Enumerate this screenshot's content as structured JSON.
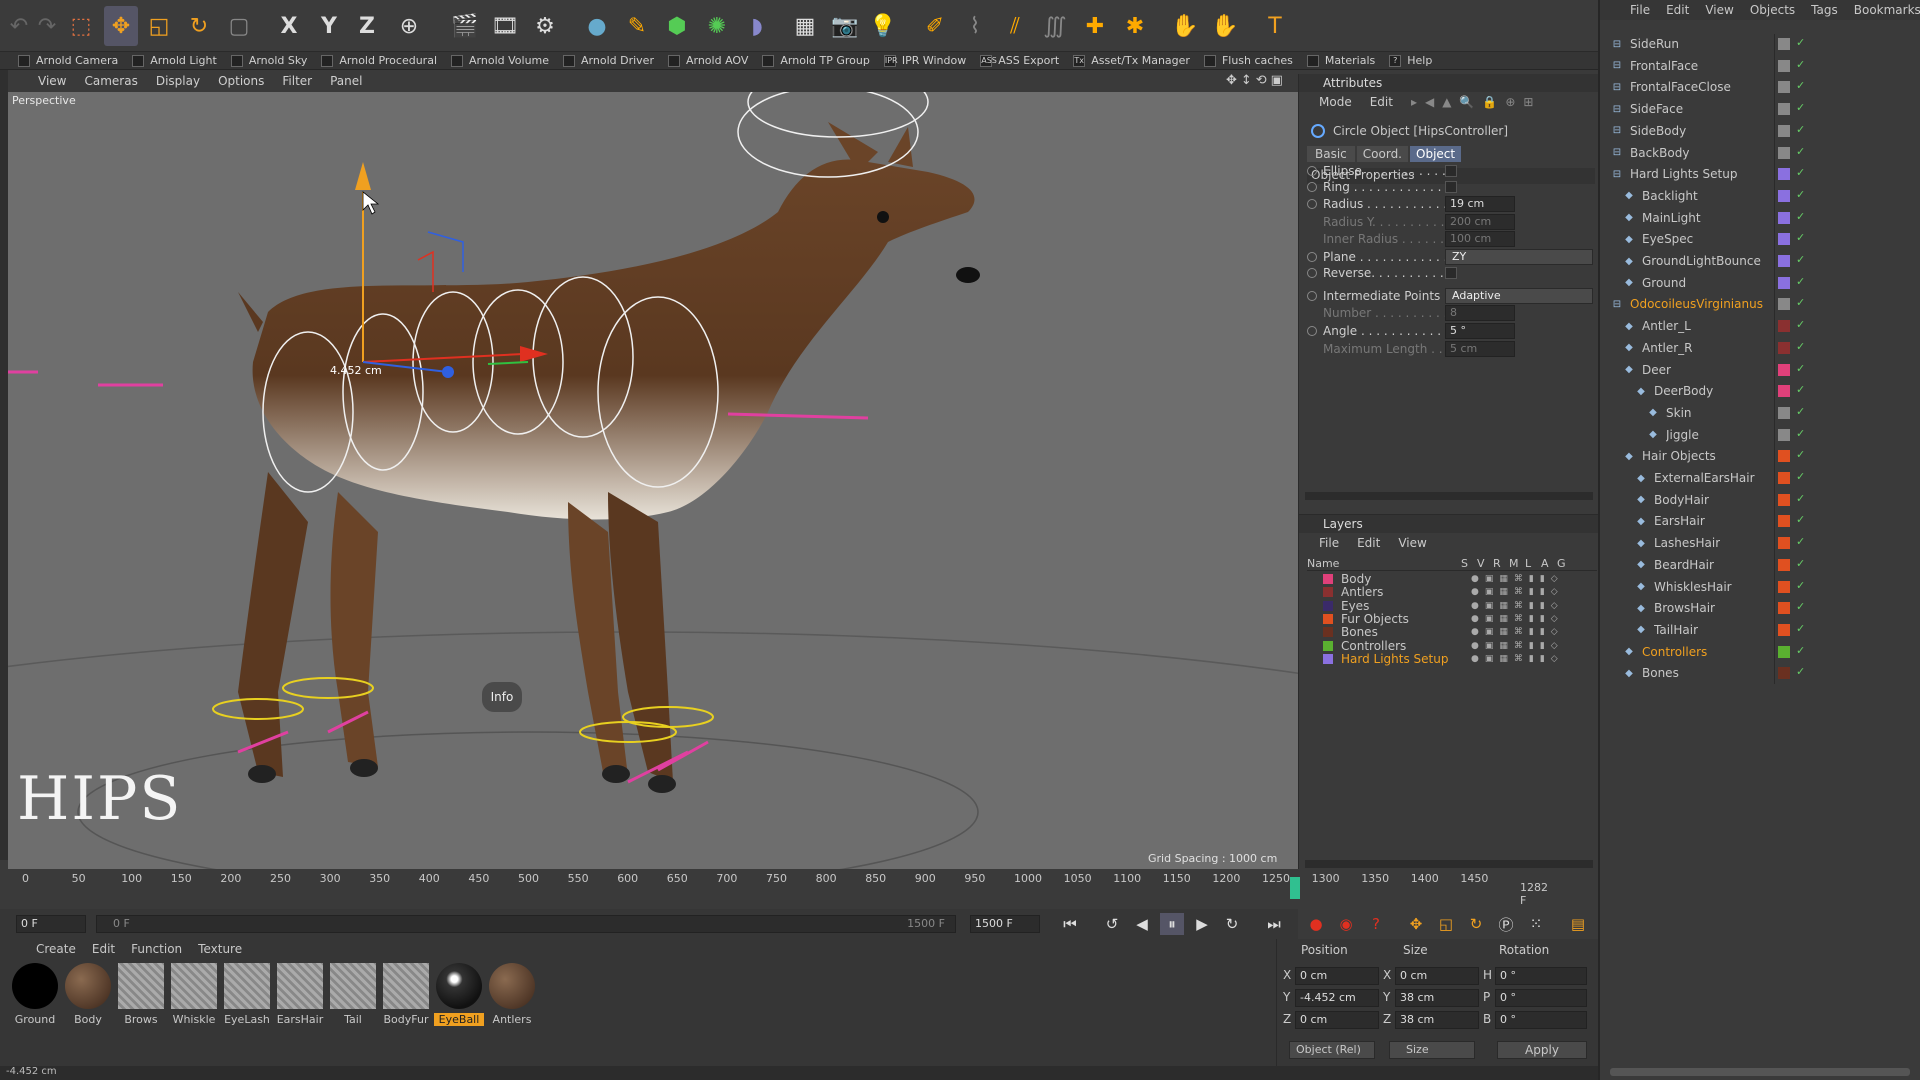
{
  "toolbar_secondary": [
    "Arnold Camera",
    "Arnold Light",
    "Arnold Sky",
    "Arnold Procedural",
    "Arnold Volume",
    "Arnold Driver",
    "Arnold AOV",
    "Arnold TP Group",
    "IPR Window",
    "ASS Export",
    "Asset/Tx Manager",
    "Flush caches",
    "Materials",
    "Help"
  ],
  "toolbar_secondary_icons": [
    "",
    "",
    "",
    "",
    "",
    "",
    "",
    "",
    "IPR",
    "ASS",
    "Tx",
    "",
    "",
    "?"
  ],
  "toolbar_axis": [
    "X",
    "Y",
    "Z"
  ],
  "viewport": {
    "menu": [
      "View",
      "Cameras",
      "Display",
      "Options",
      "Filter",
      "Panel"
    ],
    "label": "Perspective",
    "measure": "4.452 cm",
    "info_button": "Info",
    "big_title": "HIPS",
    "grid_spacing": "Grid Spacing : 1000 cm"
  },
  "attributes": {
    "title": "Attributes",
    "menu": [
      "Mode",
      "Edit"
    ],
    "object_name": "Circle Object [HipsController]",
    "tabs": [
      "Basic",
      "Coord.",
      "Object"
    ],
    "active_tab": "Object",
    "section": "Object Properties",
    "props": [
      {
        "label": "Ellipse . . . . . . . . . . .",
        "type": "check",
        "value": ""
      },
      {
        "label": "Ring . . . . . . . . . . . . .",
        "type": "check",
        "value": ""
      },
      {
        "label": "Radius . . . . . . . . . . .",
        "type": "value",
        "value": "19 cm"
      },
      {
        "label": "Radius Y. . . . . . . . . .",
        "type": "value",
        "value": "200 cm",
        "dim": true
      },
      {
        "label": "Inner Radius . . . . . .",
        "type": "value",
        "value": "100 cm",
        "dim": true
      },
      {
        "label": "Plane . . . . . . . . . . . .",
        "type": "dropdown",
        "value": "ZY"
      },
      {
        "label": "Reverse. . . . . . . . . . .",
        "type": "check",
        "value": ""
      },
      {
        "label": "Intermediate Points",
        "type": "dropdown",
        "value": "Adaptive"
      },
      {
        "label": "Number . . . . . . . . . . .",
        "type": "value",
        "value": "8",
        "dim": true
      },
      {
        "label": "Angle . . . . . . . . . . . .",
        "type": "value",
        "value": "5 °"
      },
      {
        "label": "Maximum Length . .",
        "type": "value",
        "value": "5 cm",
        "dim": true
      }
    ]
  },
  "layers": {
    "title": "Layers",
    "menu": [
      "File",
      "Edit",
      "View"
    ],
    "col_name": "Name",
    "cols": [
      "S",
      "V",
      "R",
      "M",
      "L",
      "A",
      "G"
    ],
    "items": [
      {
        "name": "Body",
        "color": "#e0407a"
      },
      {
        "name": "Antlers",
        "color": "#8a3030"
      },
      {
        "name": "Eyes",
        "color": "#3a2a6a"
      },
      {
        "name": "Fur Objects",
        "color": "#e05020"
      },
      {
        "name": "Bones",
        "color": "#6a3020"
      },
      {
        "name": "Controllers",
        "color": "#5ab030"
      },
      {
        "name": "Hard Lights Setup",
        "color": "#8a70e0",
        "highlight": true
      }
    ]
  },
  "objects": {
    "menu": [
      "File",
      "Edit",
      "View",
      "Objects",
      "Tags",
      "Bookmarks"
    ],
    "items": [
      {
        "name": "SideRun",
        "indent": 0,
        "color": "#888"
      },
      {
        "name": "FrontalFace",
        "indent": 0,
        "color": "#888"
      },
      {
        "name": "FrontalFaceClose",
        "indent": 0,
        "color": "#888"
      },
      {
        "name": "SideFace",
        "indent": 0,
        "color": "#888"
      },
      {
        "name": "SideBody",
        "indent": 0,
        "color": "#888"
      },
      {
        "name": "BackBody",
        "indent": 0,
        "color": "#888"
      },
      {
        "name": "Hard Lights Setup",
        "indent": 0,
        "color": "#8a70e0"
      },
      {
        "name": "Backlight",
        "indent": 1,
        "color": "#8a70e0"
      },
      {
        "name": "MainLight",
        "indent": 1,
        "color": "#8a70e0"
      },
      {
        "name": "EyeSpec",
        "indent": 1,
        "color": "#8a70e0"
      },
      {
        "name": "GroundLightBounce",
        "indent": 1,
        "color": "#8a70e0"
      },
      {
        "name": "Ground",
        "indent": 1,
        "color": "#8a70e0"
      },
      {
        "name": "OdocoileusVirginianus",
        "indent": 0,
        "color": "#888",
        "orange": true
      },
      {
        "name": "Antler_L",
        "indent": 1,
        "color": "#8a3030"
      },
      {
        "name": "Antler_R",
        "indent": 1,
        "color": "#8a3030"
      },
      {
        "name": "Deer",
        "indent": 1,
        "color": "#e0407a"
      },
      {
        "name": "DeerBody",
        "indent": 2,
        "color": "#e0407a"
      },
      {
        "name": "Skin",
        "indent": 3,
        "color": "#888"
      },
      {
        "name": "Jiggle",
        "indent": 3,
        "color": "#888"
      },
      {
        "name": "Hair Objects",
        "indent": 1,
        "color": "#e05020"
      },
      {
        "name": "ExternalEarsHair",
        "indent": 2,
        "color": "#e05020"
      },
      {
        "name": "BodyHair",
        "indent": 2,
        "color": "#e05020"
      },
      {
        "name": "EarsHair",
        "indent": 2,
        "color": "#e05020"
      },
      {
        "name": "LashesHair",
        "indent": 2,
        "color": "#e05020"
      },
      {
        "name": "BeardHair",
        "indent": 2,
        "color": "#e05020"
      },
      {
        "name": "WhisklesHair",
        "indent": 2,
        "color": "#e05020"
      },
      {
        "name": "BrowsHair",
        "indent": 2,
        "color": "#e05020"
      },
      {
        "name": "TailHair",
        "indent": 2,
        "color": "#e05020"
      },
      {
        "name": "Controllers",
        "indent": 1,
        "color": "#5ab030",
        "orange": true
      },
      {
        "name": "Bones",
        "indent": 1,
        "color": "#6a3020"
      }
    ]
  },
  "timeline": {
    "ticks": [
      "0",
      "50",
      "100",
      "150",
      "200",
      "250",
      "300",
      "350",
      "400",
      "450",
      "500",
      "550",
      "600",
      "650",
      "700",
      "750",
      "800",
      "850",
      "900",
      "950",
      "1000",
      "1050",
      "1100",
      "1150",
      "1200",
      "1250",
      "1300",
      "1350",
      "1400",
      "1450"
    ],
    "current": "1282 F",
    "start_field": "0 F",
    "range_start": "0 F",
    "range_end": "1500 F",
    "end_field": "1500 F"
  },
  "materials": {
    "menu": [
      "Create",
      "Edit",
      "Function",
      "Texture"
    ],
    "items": [
      {
        "name": "Ground",
        "kind": "black"
      },
      {
        "name": "Body",
        "kind": "brown"
      },
      {
        "name": "Brows",
        "kind": "hair"
      },
      {
        "name": "Whiskle",
        "kind": "hair"
      },
      {
        "name": "EyeLash",
        "kind": "hair"
      },
      {
        "name": "EarsHair",
        "kind": "hair"
      },
      {
        "name": "Tail",
        "kind": "hair"
      },
      {
        "name": "BodyFur",
        "kind": "hair"
      },
      {
        "name": "EyeBall",
        "kind": "eye",
        "selected": true
      },
      {
        "name": "Antlers",
        "kind": "brown"
      }
    ]
  },
  "coords": {
    "headers": [
      "Position",
      "Size",
      "Rotation"
    ],
    "pos": {
      "x": "0 cm",
      "y": "-4.452 cm",
      "z": "0 cm"
    },
    "size": {
      "x": "0 cm",
      "y": "38 cm",
      "z": "38 cm"
    },
    "rot": {
      "h": "0 °",
      "p": "0 °",
      "b": "0 °"
    },
    "axis_labels": {
      "x": "X",
      "y": "Y",
      "z": "Z",
      "h": "H",
      "p": "P",
      "b": "B"
    },
    "mode": "Object (Rel)",
    "size_mode": "Size",
    "apply": "Apply"
  },
  "status": "-4.452 cm"
}
